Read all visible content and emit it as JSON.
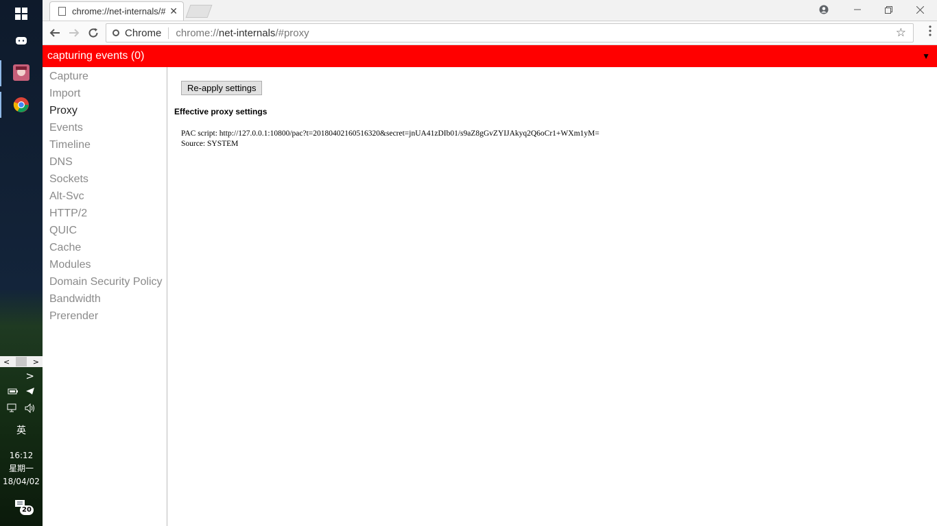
{
  "taskbar": {
    "scroll_left": "<",
    "scroll_right": ">",
    "expand": ">",
    "ime": "英",
    "time": "16:12",
    "weekday": "星期一",
    "date": "18/04/02",
    "notification_count": "20"
  },
  "tabs": [
    {
      "title": "chrome://net-internals/#proxy",
      "close": "✕"
    }
  ],
  "omnibox": {
    "chip_label": "Chrome",
    "url_prefix": "chrome://",
    "url_host": "net-internals",
    "url_rest": "/#proxy"
  },
  "status_bar": {
    "text": "capturing events (0)",
    "arrow": "▼",
    "color": "#ff0000"
  },
  "sidebar": {
    "items": [
      {
        "label": "Capture",
        "selected": false
      },
      {
        "label": "Import",
        "selected": false
      },
      {
        "label": "Proxy",
        "selected": true
      },
      {
        "label": "Events",
        "selected": false
      },
      {
        "label": "Timeline",
        "selected": false
      },
      {
        "label": "DNS",
        "selected": false
      },
      {
        "label": "Sockets",
        "selected": false
      },
      {
        "label": "Alt-Svc",
        "selected": false
      },
      {
        "label": "HTTP/2",
        "selected": false
      },
      {
        "label": "QUIC",
        "selected": false
      },
      {
        "label": "Cache",
        "selected": false
      },
      {
        "label": "Modules",
        "selected": false
      },
      {
        "label": "Domain Security Policy",
        "selected": false
      },
      {
        "label": "Bandwidth",
        "selected": false
      },
      {
        "label": "Prerender",
        "selected": false
      }
    ]
  },
  "proxy": {
    "reapply_label": "Re-apply settings",
    "effective_title": "Effective proxy settings",
    "pac_line": "PAC script: http://127.0.0.1:10800/pac?t=20180402160516320&secret=jnUA41zDIb01/s9aZ8gGvZYIJAkyq2Q6oCr1+WXm1yM=",
    "source_line": "Source: SYSTEM"
  }
}
